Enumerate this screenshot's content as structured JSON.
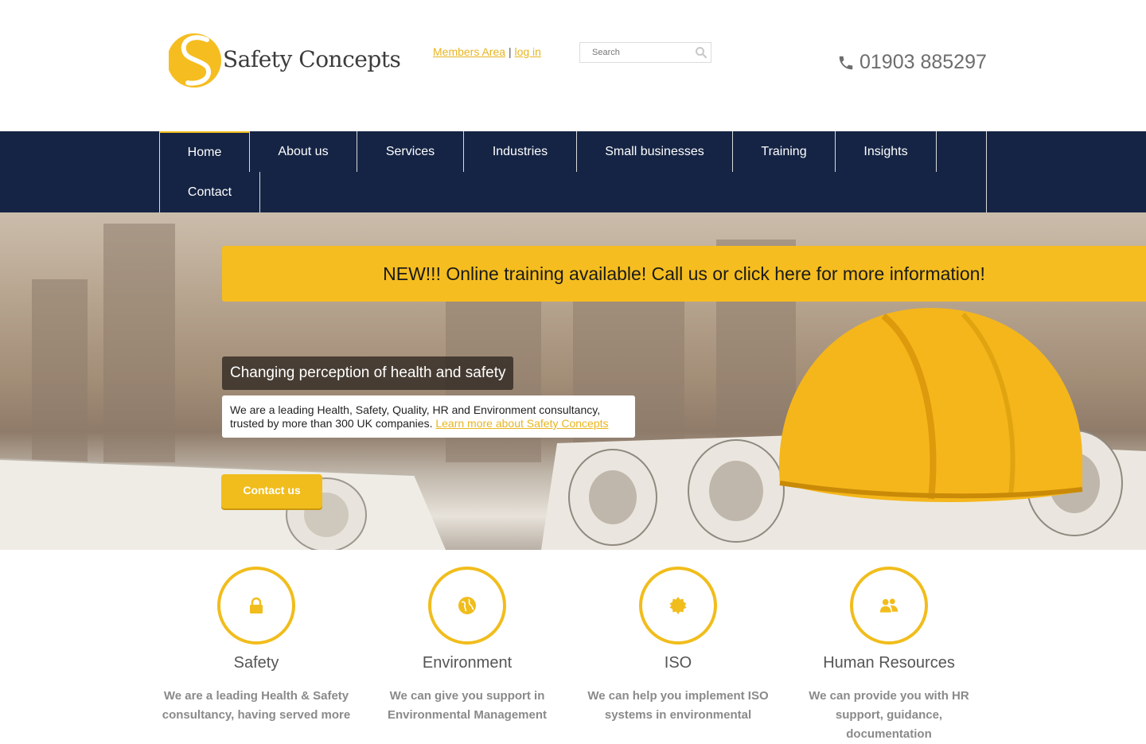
{
  "header": {
    "logo_text": "Safety Concepts",
    "members_label": "Members Area",
    "separator": "|",
    "login_label": "log in",
    "search_placeholder": "Search",
    "phone": "01903 885297"
  },
  "nav": {
    "items": [
      {
        "label": "Home"
      },
      {
        "label": "About us"
      },
      {
        "label": "Services"
      },
      {
        "label": "Industries"
      },
      {
        "label": "Small businesses"
      },
      {
        "label": "Training"
      },
      {
        "label": "Insights"
      },
      {
        "label": "Contact"
      }
    ]
  },
  "hero": {
    "banner": "NEW!!! Online training available! Call us or click here for more information!",
    "tagline": "Changing perception of health and safety",
    "about_text": "We are a leading Health, Safety, Quality, HR and Environment consultancy, trusted by more than 300 UK companies.",
    "about_link": "Learn more about Safety Concepts",
    "contact_button": "Contact us"
  },
  "services": [
    {
      "title": "Safety",
      "icon": "lock-icon",
      "desc": "We are a leading Health & Safety consultancy, having served more"
    },
    {
      "title": "Environment",
      "icon": "globe-icon",
      "desc": "We can give you support in Environmental Management"
    },
    {
      "title": "ISO",
      "icon": "badge-icon",
      "desc": "We can help you implement ISO systems in environmental"
    },
    {
      "title": "Human Resources",
      "icon": "users-icon",
      "desc": "We can provide you with HR support, guidance, documentation"
    }
  ],
  "colors": {
    "accent": "#f1bd1c",
    "nav": "#152444",
    "link": "#e8b520"
  }
}
